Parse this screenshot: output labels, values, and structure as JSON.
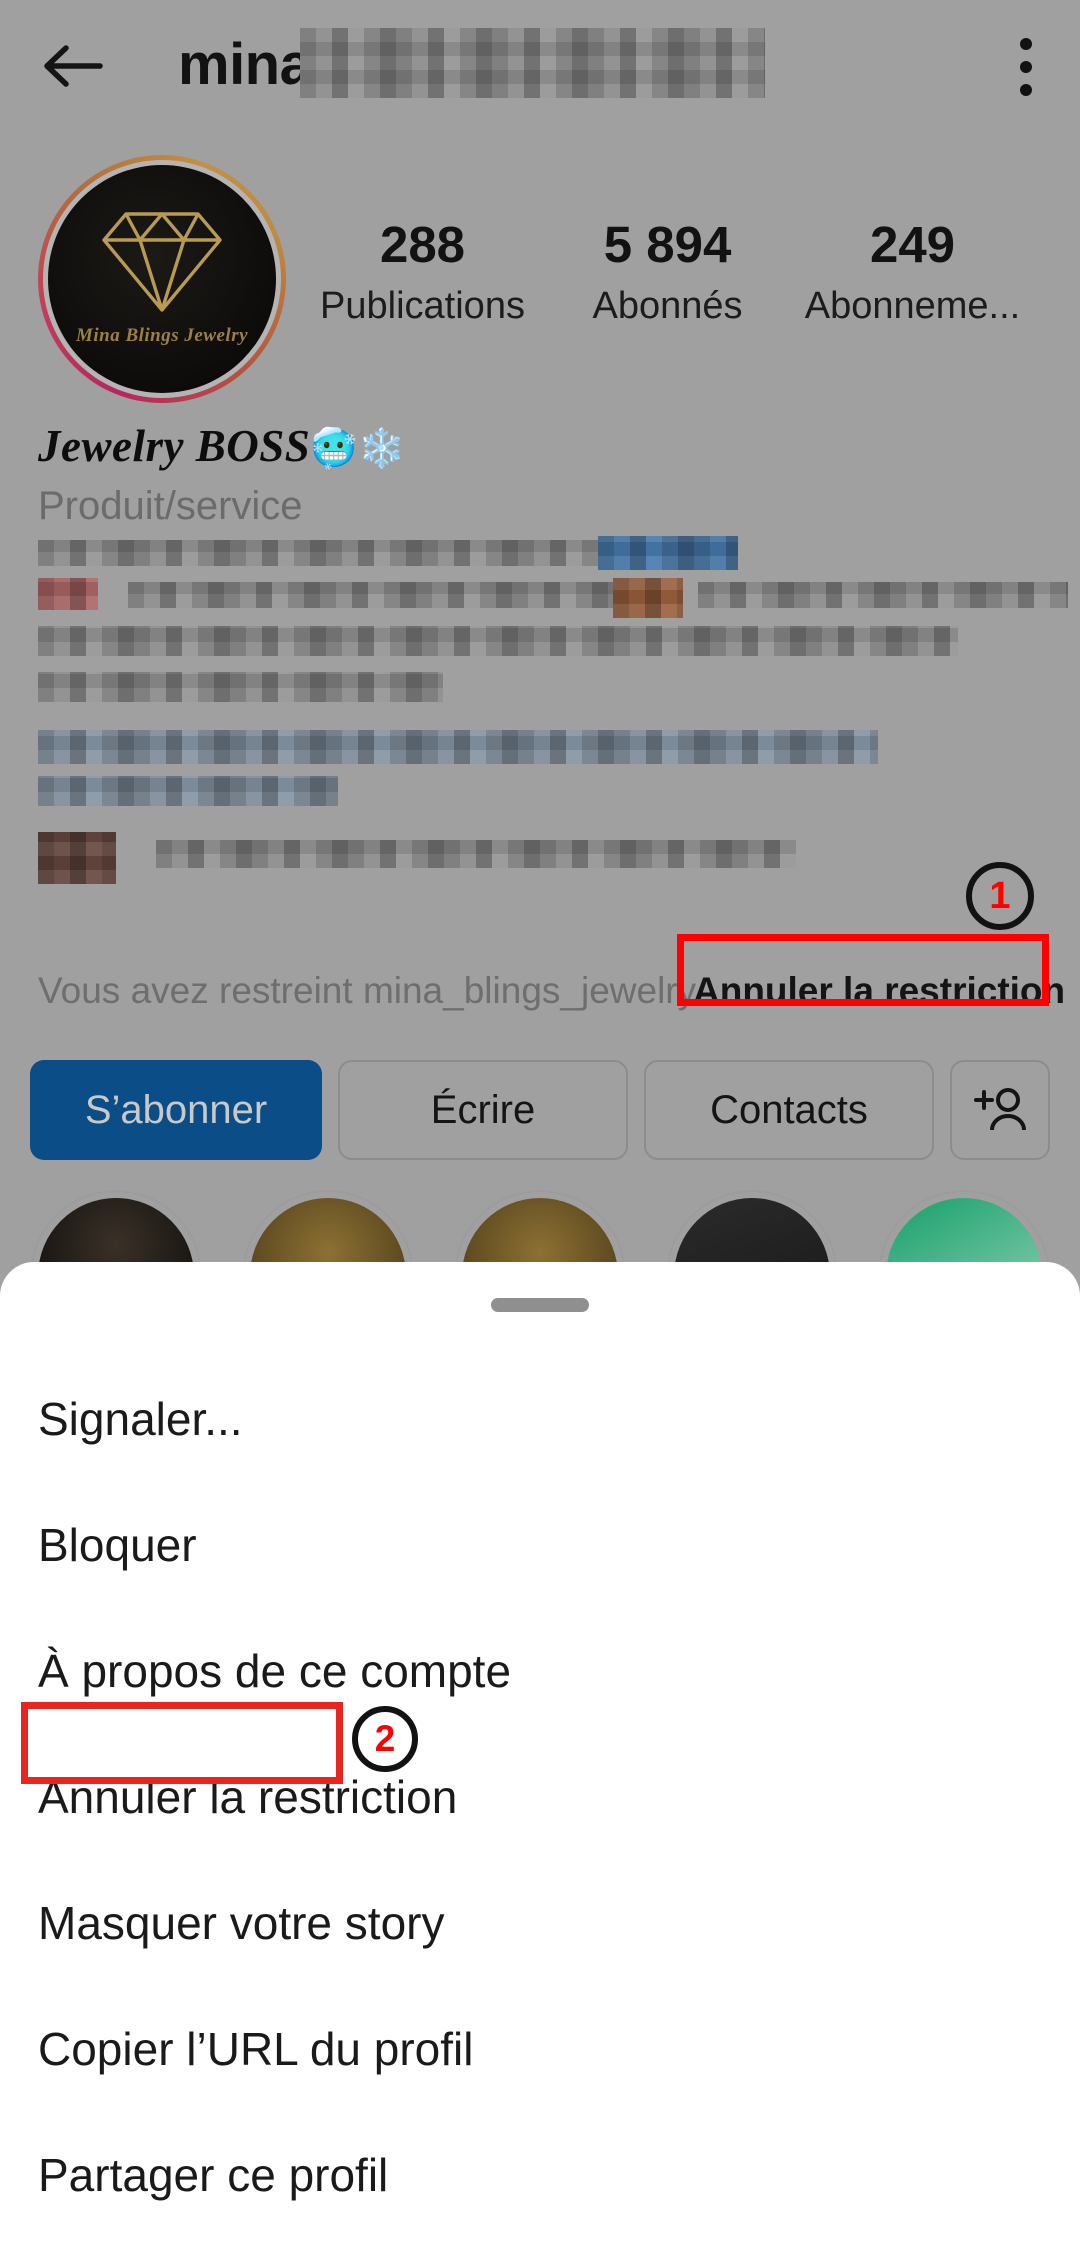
{
  "appbar": {
    "back_icon": "back-arrow-icon",
    "username": "mina_",
    "username_censored": true,
    "overflow_icon": "kebab-menu-icon"
  },
  "profile": {
    "avatar": {
      "icon": "diamond-icon",
      "brand_text": "Mina Blings Jewelry",
      "has_story_ring": true,
      "ring_colors": [
        "#b8255f",
        "#b4703a",
        "#c39044"
      ]
    },
    "stats": [
      {
        "value": "288",
        "label": "Publications"
      },
      {
        "value": "5 894",
        "label": "Abonnés"
      },
      {
        "value": "249",
        "label": "Abonneme..."
      }
    ],
    "display_name": "Jewelry BOSS",
    "display_name_emojis": "🥶❄️",
    "category": "Produit/service",
    "bio_censored": true
  },
  "restriction": {
    "text": "Vous avez restreint mina_blings_jewelry.",
    "action_label": "Annuler la restriction",
    "highlight_color": "#ff0000",
    "badge": "1",
    "badge_color": "#ff0000"
  },
  "actions": {
    "follow_label": "S’abonner",
    "message_label": "Écrire",
    "contacts_label": "Contacts",
    "add_person_icon": "add-person-icon"
  },
  "sheet": {
    "handle_icon": "drag-handle",
    "items": [
      {
        "label": "Signaler...",
        "highlighted": false
      },
      {
        "label": "Bloquer",
        "highlighted": false
      },
      {
        "label": "À propos de ce compte",
        "highlighted": false
      },
      {
        "label": "Annuler la restriction",
        "highlighted": true,
        "badge": "2"
      },
      {
        "label": "Masquer votre story",
        "highlighted": false
      },
      {
        "label": "Copier l’URL du profil",
        "highlighted": false
      },
      {
        "label": "Partager ce profil",
        "highlighted": false
      }
    ],
    "highlight_color": "#e8251f",
    "badge_color": "#ff0000"
  },
  "colors": {
    "accent_blue": "#0a4d87",
    "scrim": "#a0a0a0",
    "sheet_bg": "#ffffff",
    "text_primary": "#1a1a1a",
    "text_muted": "#6e6e6e"
  }
}
